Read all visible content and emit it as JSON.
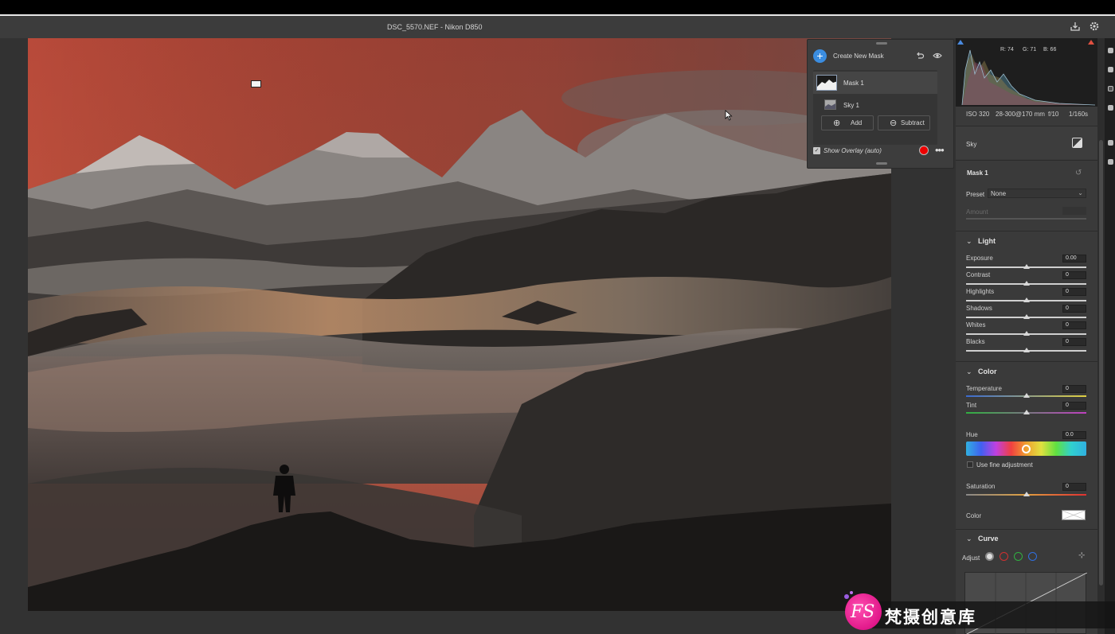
{
  "window": {
    "title": "DSC_5570.NEF  -  Nikon D850"
  },
  "toolbar": {
    "save_icon": "download-icon",
    "settings_icon": "gear-icon"
  },
  "mask_panel": {
    "create_label": "Create New Mask",
    "masks": [
      {
        "name": "Mask 1",
        "selected": true
      },
      {
        "name": "Sky 1",
        "selected": false
      }
    ],
    "add_label": "Add",
    "subtract_label": "Subtract",
    "show_overlay_label": "Show Overlay (auto)",
    "show_overlay_checked": true,
    "overlay_color": "#e00000"
  },
  "histogram": {
    "r": "R: 74",
    "g": "G: 71",
    "b": "B: 66"
  },
  "exif": {
    "iso": "ISO 320",
    "lens": "28-300@170 mm",
    "aperture": "f/10",
    "shutter": "1/160s"
  },
  "sky_section": {
    "label": "Sky"
  },
  "mask_settings": {
    "title": "Mask 1",
    "preset_label": "Preset",
    "preset_value": "None",
    "amount_label": "Amount"
  },
  "light": {
    "title": "Light",
    "sliders": [
      {
        "label": "Exposure",
        "value": "0.00"
      },
      {
        "label": "Contrast",
        "value": "0"
      },
      {
        "label": "Highlights",
        "value": "0"
      },
      {
        "label": "Shadows",
        "value": "0"
      },
      {
        "label": "Whites",
        "value": "0"
      },
      {
        "label": "Blacks",
        "value": "0"
      }
    ]
  },
  "color": {
    "title": "Color",
    "temperature_label": "Temperature",
    "temperature_value": "0",
    "tint_label": "Tint",
    "tint_value": "0",
    "hue_label": "Hue",
    "hue_value": "0.0",
    "fine_adjust_label": "Use fine adjustment",
    "saturation_label": "Saturation",
    "saturation_value": "0",
    "color_label": "Color"
  },
  "curve": {
    "title": "Curve",
    "adjust_label": "Adjust"
  },
  "watermark": {
    "logo_text": "FS",
    "text": "梵摄创意库"
  }
}
